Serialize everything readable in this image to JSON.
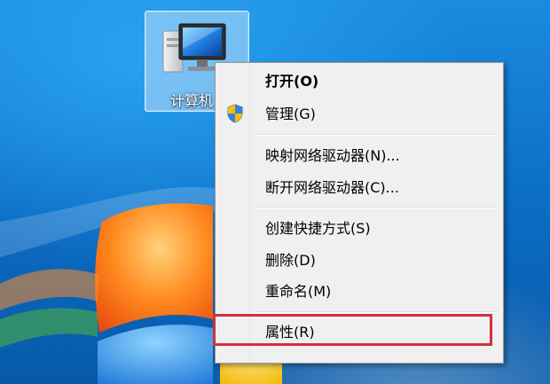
{
  "desktop": {
    "computer_icon": {
      "label": "计算机",
      "icon": "computer-icon"
    }
  },
  "context_menu": {
    "items": [
      {
        "label": "打开(O)",
        "bold": true
      },
      {
        "label": "管理(G)",
        "icon": "shield-icon"
      },
      {
        "label": "映射网络驱动器(N)..."
      },
      {
        "label": "断开网络驱动器(C)..."
      },
      {
        "label": "创建快捷方式(S)"
      },
      {
        "label": "删除(D)"
      },
      {
        "label": "重命名(M)"
      },
      {
        "label": "属性(R)",
        "highlighted": true
      }
    ],
    "highlight_color": "#d0313a"
  }
}
